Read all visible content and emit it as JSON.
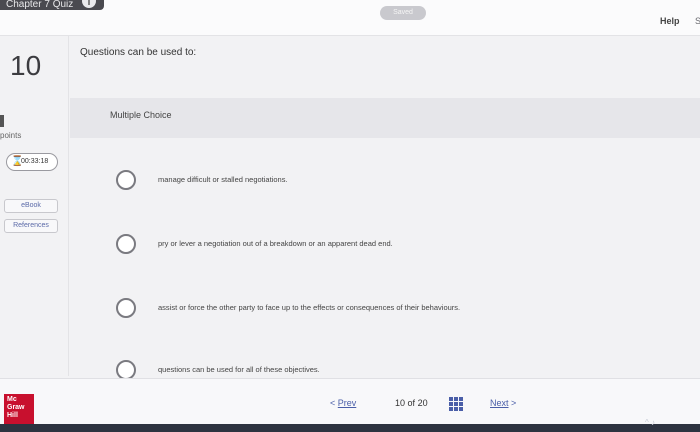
{
  "header": {
    "tab_title": "Chapter 7 Quiz",
    "info_icon": "i",
    "saved_label": "Saved",
    "help_label": "Help",
    "help_extra": "S"
  },
  "sidebar": {
    "question_number": "10",
    "points_label": "points",
    "timer": "00:33:18",
    "ebook_label": "eBook",
    "references_label": "References"
  },
  "question": {
    "text": "Questions can be used to:",
    "type": "Multiple Choice",
    "options": [
      "manage difficult or stalled negotiations.",
      "pry or lever a negotiation out of a breakdown or an apparent dead end.",
      "assist or force the other party to face up to the effects or consequences of their behaviours.",
      "questions can be used for all of these objectives."
    ]
  },
  "footer": {
    "logo_line1": "Mc",
    "logo_line2": "Graw",
    "logo_line3": "Hill",
    "prev_label": "Prev",
    "page_current": "10",
    "page_of": "of",
    "page_total": "20",
    "next_label": "Next"
  },
  "icons": {
    "timer": "hourglass-icon",
    "grid": "grid-icon",
    "prev": "chevron-left-icon",
    "next": "chevron-right-icon"
  }
}
